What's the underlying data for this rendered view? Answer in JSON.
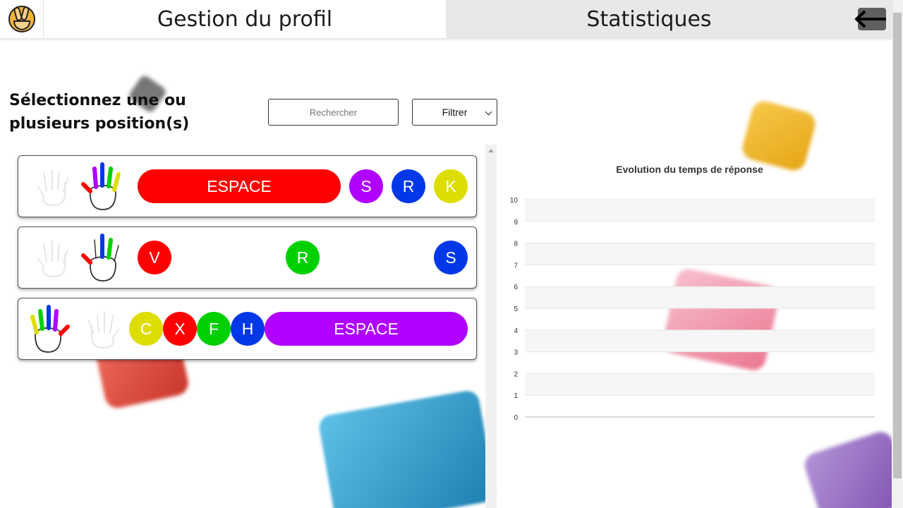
{
  "header": {
    "tabs": [
      {
        "label": "Gestion du profil"
      },
      {
        "label": "Statistiques"
      }
    ],
    "back_icon": "arrow-left-icon"
  },
  "selection": {
    "title": "Sélectionnez une ou plusieurs position(s)",
    "search_placeholder": "Rechercher",
    "filter_selected": "Filtrer"
  },
  "positions": [
    {
      "active_hand": "right",
      "keys": [
        {
          "label": "ESPACE",
          "color": "#ff0000",
          "shape": "pill"
        },
        {
          "label": "S",
          "color": "#b000ff",
          "shape": "circle"
        },
        {
          "label": "R",
          "color": "#0038e8",
          "shape": "circle"
        },
        {
          "label": "K",
          "color": "#dddd00",
          "shape": "circle"
        }
      ]
    },
    {
      "active_hand": "right",
      "keys": [
        {
          "label": "V",
          "color": "#ff0000",
          "shape": "circle"
        },
        {
          "label": "R",
          "color": "#00d000",
          "shape": "circle"
        },
        {
          "label": "S",
          "color": "#0038e8",
          "shape": "circle"
        }
      ]
    },
    {
      "active_hand": "left",
      "keys": [
        {
          "label": "C",
          "color": "#dddd00",
          "shape": "circle"
        },
        {
          "label": "X",
          "color": "#ff0000",
          "shape": "circle"
        },
        {
          "label": "F",
          "color": "#00d000",
          "shape": "circle"
        },
        {
          "label": "H",
          "color": "#0038e8",
          "shape": "circle"
        },
        {
          "label": "ESPACE",
          "color": "#b000ff",
          "shape": "pill"
        }
      ]
    }
  ],
  "chart_data": {
    "type": "line",
    "title": "Evolution du temps de réponse",
    "xlabel": "",
    "ylabel": "",
    "ylim": [
      0,
      10
    ],
    "yticks": [
      "0",
      "1",
      "2",
      "3",
      "4",
      "5",
      "6",
      "7",
      "8",
      "9",
      "10"
    ],
    "series": [],
    "grid": true
  },
  "colors": {
    "red": "#ff0000",
    "purple": "#b000ff",
    "blue": "#0038e8",
    "yellow": "#dddd00",
    "green": "#00d000",
    "tab_inactive": "#e8e8e8"
  }
}
